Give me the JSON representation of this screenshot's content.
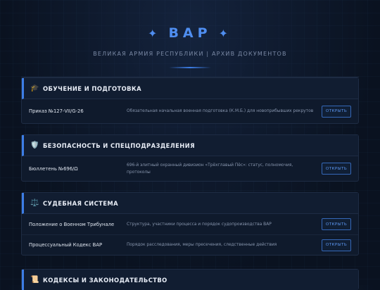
{
  "header": {
    "star_left": "✦",
    "title": "ВАР",
    "star_right": "✦",
    "subtitle": "ВЕЛИКАЯ АРМИЯ РЕСПУБЛИКИ | АРХИВ ДОКУМЕНТОВ"
  },
  "sections": [
    {
      "icon": "🎓",
      "icon_name": "graduation-cap-icon",
      "title": "ОБУЧЕНИЕ И ПОДГОТОВКА",
      "rows": [
        {
          "name": "Приказ №127-VII/G-26",
          "desc": "Обязательная начальная военная подготовка (К.М.Б.) для новоприбывших рекрутов",
          "button": "ОТКРЫТЬ"
        }
      ]
    },
    {
      "icon": "🛡️",
      "icon_name": "shield-icon",
      "title": "БЕЗОПАСНОСТЬ И СПЕЦПОДРАЗДЕЛЕНИЯ",
      "rows": [
        {
          "name": "Бюллетень №696/Ω",
          "desc": "696-й элитный охранный дивизион «Трёхглавый Пёс»: статус, полномочия, протоколы",
          "button": "ОТКРЫТЬ"
        }
      ]
    },
    {
      "icon": "⚖️",
      "icon_name": "scales-icon",
      "title": "СУДЕБНАЯ СИСТЕМА",
      "rows": [
        {
          "name": "Положение о Военном Трибунале",
          "desc": "Структура, участники процесса и порядок судопроизводства ВАР",
          "button": "ОТКРЫТЬ"
        },
        {
          "name": "Процессуальный Кодекс ВАР",
          "desc": "Порядок расследования, меры пресечения, следственные действия",
          "button": "ОТКРЫТЬ"
        }
      ]
    },
    {
      "icon": "📜",
      "icon_name": "scroll-icon",
      "title": "КОДЕКСЫ И ЗАКОНОДАТЕЛЬСТВО",
      "rows": []
    }
  ],
  "colors": {
    "accent": "#3d7ee6",
    "background": "#0a1220",
    "panel": "#0f1a2c"
  }
}
